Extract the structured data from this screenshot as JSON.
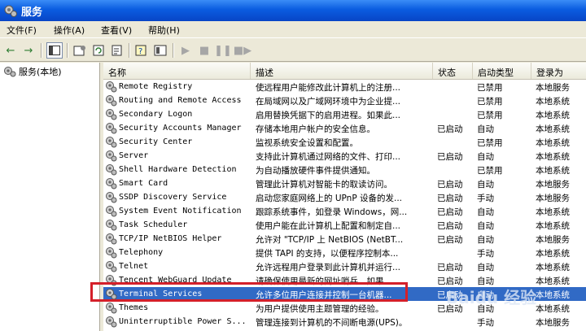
{
  "window": {
    "title": "服务"
  },
  "menu": [
    "文件(F)",
    "操作(A)",
    "查看(V)",
    "帮助(H)"
  ],
  "tree": {
    "root_label": "服务(本地)"
  },
  "columns": {
    "name": "名称",
    "description": "描述",
    "status": "状态",
    "startup": "启动类型",
    "logon": "登录为"
  },
  "rows": [
    {
      "name": "Remote Registry",
      "description": "使远程用户能修改此计算机上的注册...",
      "status": "",
      "startup": "已禁用",
      "logon": "本地服务"
    },
    {
      "name": "Routing and Remote Access",
      "description": "在局域网以及广域网环境中为企业提...",
      "status": "",
      "startup": "已禁用",
      "logon": "本地系统"
    },
    {
      "name": "Secondary Logon",
      "description": "启用替换凭据下的启用进程。如果此...",
      "status": "",
      "startup": "已禁用",
      "logon": "本地系统"
    },
    {
      "name": "Security Accounts Manager",
      "description": "存储本地用户帐户的安全信息。",
      "status": "已启动",
      "startup": "自动",
      "logon": "本地系统"
    },
    {
      "name": "Security Center",
      "description": "监视系统安全设置和配置。",
      "status": "",
      "startup": "已禁用",
      "logon": "本地系统"
    },
    {
      "name": "Server",
      "description": "支持此计算机通过网络的文件、打印...",
      "status": "已启动",
      "startup": "自动",
      "logon": "本地系统"
    },
    {
      "name": "Shell Hardware Detection",
      "description": "为自动播放硬件事件提供通知。",
      "status": "",
      "startup": "已禁用",
      "logon": "本地系统"
    },
    {
      "name": "Smart Card",
      "description": "管理此计算机对智能卡的取读访问。",
      "status": "已启动",
      "startup": "自动",
      "logon": "本地服务"
    },
    {
      "name": "SSDP Discovery Service",
      "description": "启动您家庭网络上的 UPnP 设备的发...",
      "status": "已启动",
      "startup": "手动",
      "logon": "本地服务"
    },
    {
      "name": "System Event Notification",
      "description": "跟踪系统事件，如登录 Windows，网...",
      "status": "已启动",
      "startup": "自动",
      "logon": "本地系统"
    },
    {
      "name": "Task Scheduler",
      "description": "使用户能在此计算机上配置和制定自...",
      "status": "已启动",
      "startup": "自动",
      "logon": "本地系统"
    },
    {
      "name": "TCP/IP NetBIOS Helper",
      "description": "允许对 \"TCP/IP 上 NetBIOS (NetBT...",
      "status": "已启动",
      "startup": "自动",
      "logon": "本地服务"
    },
    {
      "name": "Telephony",
      "description": "提供 TAPI 的支持，以便程序控制本...",
      "status": "",
      "startup": "手动",
      "logon": "本地系统"
    },
    {
      "name": "Telnet",
      "description": "允许远程用户登录到此计算机并运行...",
      "status": "已启动",
      "startup": "自动",
      "logon": "本地系统"
    },
    {
      "name": "Tencent WebGuard Update",
      "description": "请确保使用最新的网址哨兵。如果...",
      "status": "已启动",
      "startup": "自动",
      "logon": "本地系统"
    },
    {
      "name": "Terminal Services",
      "description": "允许多位用户连接并控制一台机器...",
      "status": "已启动",
      "startup": "自动",
      "logon": "本地系统"
    },
    {
      "name": "Themes",
      "description": "为用户提供使用主题管理的经验。",
      "status": "已启动",
      "startup": "自动",
      "logon": "本地系统"
    },
    {
      "name": "Uninterruptible Power S...",
      "description": "管理连接到计算机的不间断电源(UPS)。",
      "status": "",
      "startup": "手动",
      "logon": "本地服务"
    }
  ],
  "watermark": "Baidu 经验"
}
